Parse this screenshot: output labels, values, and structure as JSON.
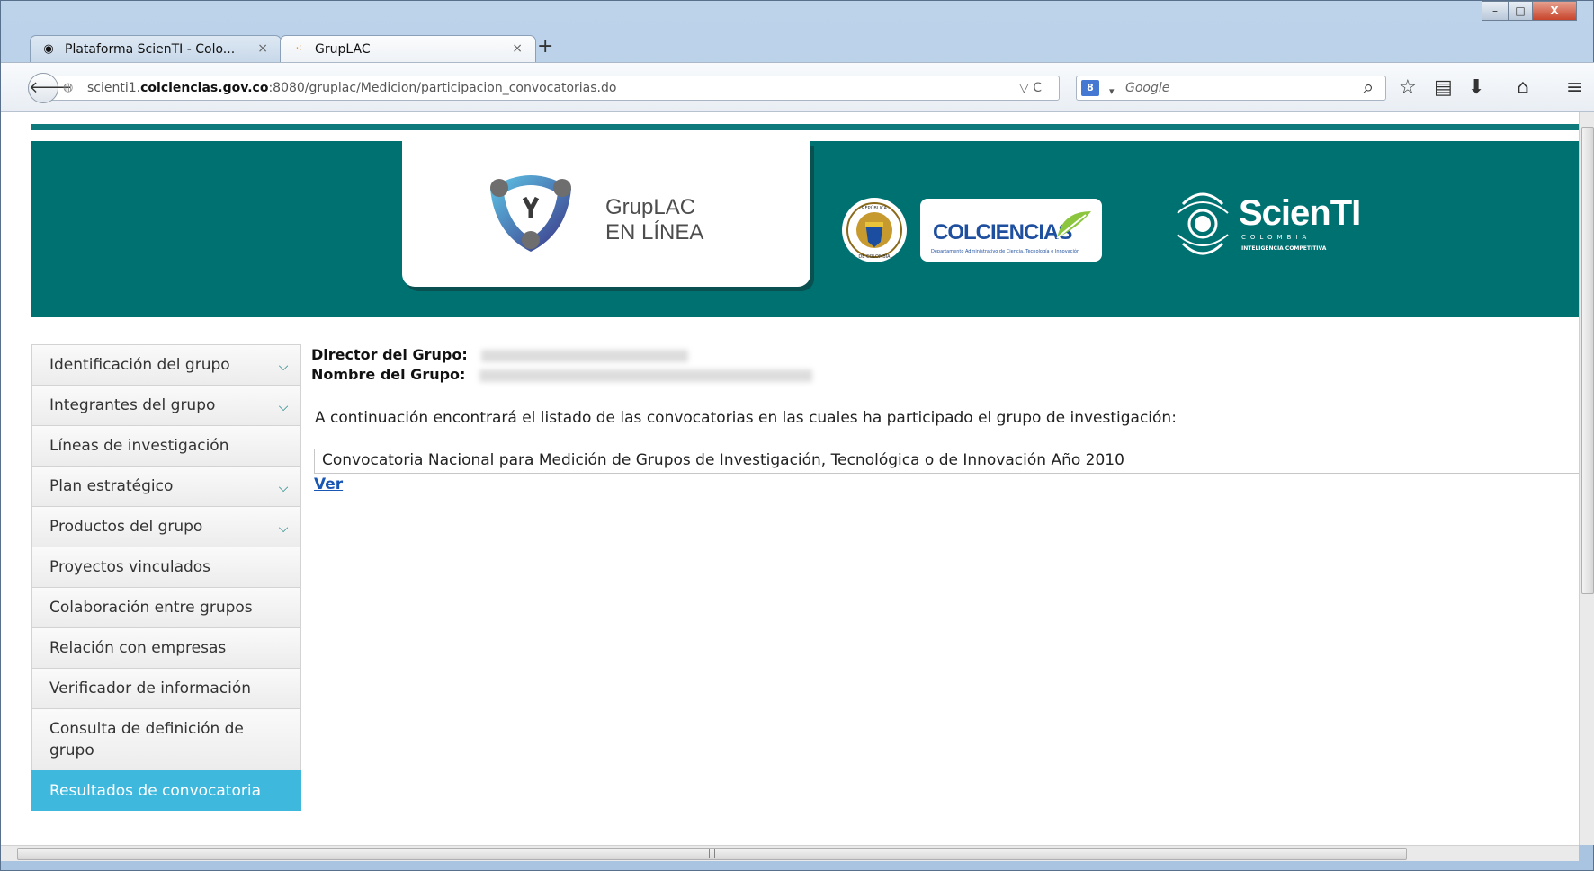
{
  "browser": {
    "tabs": [
      {
        "label": "Plataforma ScienTI - Colo...",
        "close": "×"
      },
      {
        "label": "GrupLAC",
        "close": "×"
      }
    ],
    "new_tab": "+",
    "window_buttons": {
      "minimize": "–",
      "maximize": "□",
      "close": "X"
    },
    "url": {
      "prefix": "scienti1.",
      "domain": "colciencias.gov.co",
      "suffix": ":8080/gruplac/Medicion/participacion_convocatorias.do"
    },
    "search_placeholder": "Google",
    "search_engine_badge": "8"
  },
  "banner": {
    "app_name_line1": "GrupLAC",
    "app_name_line2": "EN LÍNEA",
    "colciencias": "COLCIENCIAS",
    "colciencias_sub": "Departamento Administrativo de Ciencia, Tecnología e Innovación",
    "scienti": "ScienTI",
    "scienti_country": "COLOMBIA",
    "scienti_tagline": "INTELIGENCIA COMPETITIVA",
    "seal_top": "REPÚBLICA",
    "seal_bottom": "DE COLOMBIA",
    "colors": {
      "banner": "#007171",
      "accent": "#3fb8de"
    }
  },
  "sidebar": {
    "items": [
      {
        "label": "Identificación del grupo",
        "expandable": true
      },
      {
        "label": "Integrantes del grupo",
        "expandable": true
      },
      {
        "label": "Líneas de investigación",
        "expandable": false
      },
      {
        "label": "Plan estratégico",
        "expandable": true
      },
      {
        "label": "Productos del grupo",
        "expandable": true
      },
      {
        "label": "Proyectos vinculados",
        "expandable": false
      },
      {
        "label": "Colaboración entre grupos",
        "expandable": false
      },
      {
        "label": "Relación con empresas",
        "expandable": false
      },
      {
        "label": "Verificador de información",
        "expandable": false
      },
      {
        "label": "Consulta de definición de grupo",
        "expandable": false
      },
      {
        "label": "Resultados de convocatoria",
        "expandable": false,
        "active": true
      }
    ]
  },
  "main": {
    "director_label": "Director del Grupo:",
    "director_value": "",
    "group_label": "Nombre del Grupo:",
    "group_value": "",
    "intro": "A continuación encontrará el listado de las convocatorias en las cuales ha participado el grupo de investigación:",
    "convocatoria": "Convocatoria Nacional para Medición de Grupos de Investigación, Tecnológica o de Innovación Año 2010",
    "view_link": "Ver"
  }
}
